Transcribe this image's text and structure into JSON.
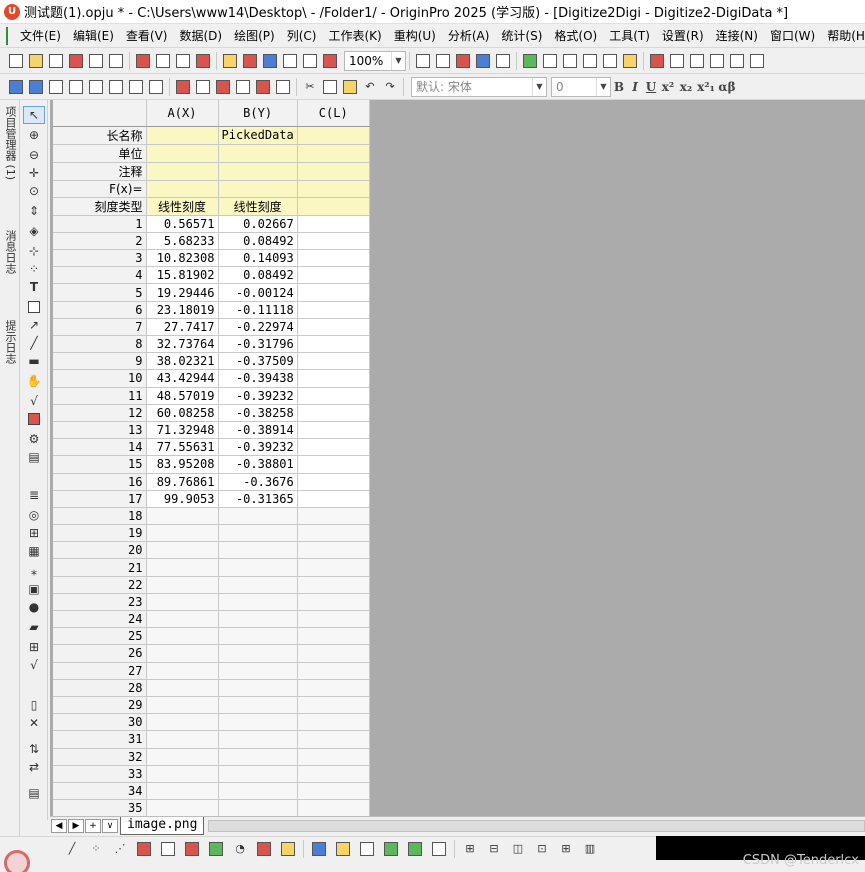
{
  "window": {
    "title": "测试题(1).opju * - C:\\Users\\www14\\Desktop\\ - /Folder1/ - OriginPro 2025 (学习版) - [Digitize2Digi - Digitize2-DigiData *]"
  },
  "menu": [
    "文件(E)",
    "编辑(E)",
    "查看(V)",
    "数据(D)",
    "绘图(P)",
    "列(C)",
    "工作表(K)",
    "重构(U)",
    "分析(A)",
    "统计(S)",
    "格式(O)",
    "工具(T)",
    "设置(R)",
    "连接(N)",
    "窗口(W)",
    "帮助(H)"
  ],
  "toolbar": {
    "zoom": "100%",
    "font_name": "默认: 宋体",
    "font_size": "0",
    "format_buttons": [
      "B",
      "I",
      "U",
      "x²",
      "x₂",
      "x²₁",
      "αβ"
    ]
  },
  "side_tabs": [
    "项目管理器 (1)",
    "消息日志",
    "提示日志"
  ],
  "worksheet": {
    "columns": [
      "A(X)",
      "B(Y)",
      "C(L)"
    ],
    "meta_rows": [
      {
        "label": "长名称",
        "values": [
          "",
          "PickedData",
          ""
        ]
      },
      {
        "label": "单位",
        "values": [
          "",
          "",
          ""
        ]
      },
      {
        "label": "注释",
        "values": [
          "",
          "",
          ""
        ]
      },
      {
        "label": "F(x)=",
        "values": [
          "",
          "",
          ""
        ]
      },
      {
        "label": "刻度类型",
        "values": [
          "线性刻度",
          "线性刻度",
          ""
        ]
      }
    ],
    "rows": [
      {
        "n": "1",
        "a": "0.56571",
        "b": "0.02667"
      },
      {
        "n": "2",
        "a": "5.68233",
        "b": "0.08492"
      },
      {
        "n": "3",
        "a": "10.82308",
        "b": "0.14093"
      },
      {
        "n": "4",
        "a": "15.81902",
        "b": "0.08492"
      },
      {
        "n": "5",
        "a": "19.29446",
        "b": "-0.00124"
      },
      {
        "n": "6",
        "a": "23.18019",
        "b": "-0.11118"
      },
      {
        "n": "7",
        "a": "27.7417",
        "b": "-0.22974"
      },
      {
        "n": "8",
        "a": "32.73764",
        "b": "-0.31796"
      },
      {
        "n": "9",
        "a": "38.02321",
        "b": "-0.37509"
      },
      {
        "n": "10",
        "a": "43.42944",
        "b": "-0.39438"
      },
      {
        "n": "11",
        "a": "48.57019",
        "b": "-0.39232"
      },
      {
        "n": "12",
        "a": "60.08258",
        "b": "-0.38258"
      },
      {
        "n": "13",
        "a": "71.32948",
        "b": "-0.38914"
      },
      {
        "n": "14",
        "a": "77.55631",
        "b": "-0.39232"
      },
      {
        "n": "15",
        "a": "83.95208",
        "b": "-0.38801"
      },
      {
        "n": "16",
        "a": "89.76861",
        "b": "-0.3676"
      },
      {
        "n": "17",
        "a": "99.9053",
        "b": "-0.31365"
      },
      {
        "n": "18",
        "a": "",
        "b": ""
      },
      {
        "n": "19",
        "a": "",
        "b": ""
      },
      {
        "n": "20",
        "a": "",
        "b": ""
      },
      {
        "n": "21",
        "a": "",
        "b": ""
      },
      {
        "n": "22",
        "a": "",
        "b": ""
      },
      {
        "n": "23",
        "a": "",
        "b": ""
      },
      {
        "n": "24",
        "a": "",
        "b": ""
      },
      {
        "n": "25",
        "a": "",
        "b": ""
      },
      {
        "n": "26",
        "a": "",
        "b": ""
      },
      {
        "n": "27",
        "a": "",
        "b": ""
      },
      {
        "n": "28",
        "a": "",
        "b": ""
      },
      {
        "n": "29",
        "a": "",
        "b": ""
      },
      {
        "n": "30",
        "a": "",
        "b": ""
      },
      {
        "n": "31",
        "a": "",
        "b": ""
      },
      {
        "n": "32",
        "a": "",
        "b": ""
      },
      {
        "n": "33",
        "a": "",
        "b": ""
      },
      {
        "n": "34",
        "a": "",
        "b": ""
      },
      {
        "n": "35",
        "a": "",
        "b": ""
      }
    ]
  },
  "sheet_tabs": {
    "nav": [
      "◀",
      "▶",
      "+",
      "∨"
    ],
    "active": "image.png"
  },
  "watermark": "CSDN @Tenderlcx"
}
